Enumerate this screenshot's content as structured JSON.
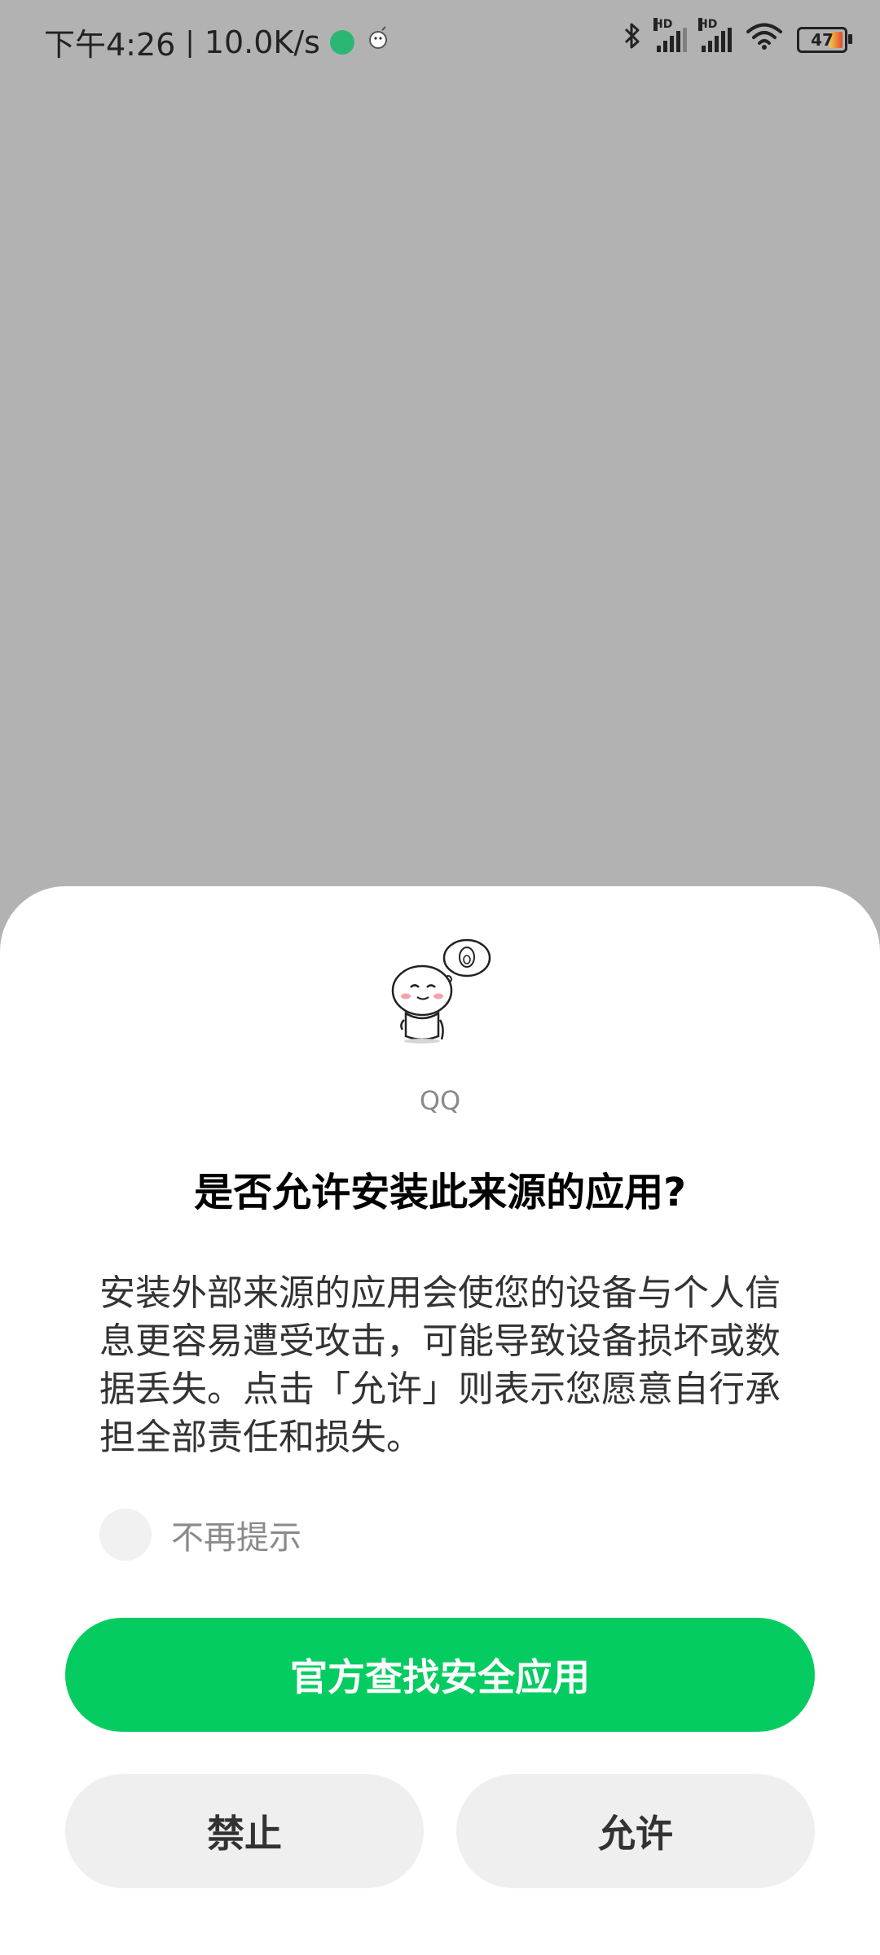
{
  "status_bar": {
    "time": "下午4:26",
    "separator": "|",
    "speed": "10.0K/s",
    "battery": "47",
    "signal_label": "HD"
  },
  "dialog": {
    "app_name": "QQ",
    "title": "是否允许安装此来源的应用?",
    "message": "安装外部来源的应用会使您的设备与个人信息更容易遭受攻击，可能导致设备损坏或数据丢失。点击「允许」则表示您愿意自行承担全部责任和损失。",
    "dont_remind_label": "不再提示",
    "primary_button": "官方查找安全应用",
    "deny_button": "禁止",
    "allow_button": "允许"
  },
  "colors": {
    "accent": "#04cc61",
    "scrim": "#b2b2b2",
    "secondary_button": "#efefef"
  }
}
